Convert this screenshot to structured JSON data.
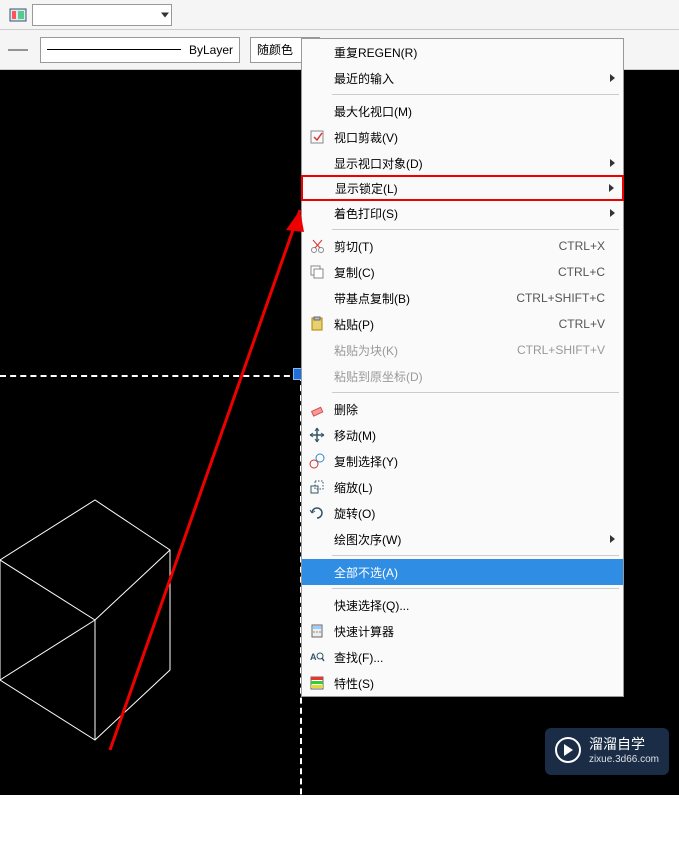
{
  "toolbar": {
    "layer_dropdown_value": "",
    "linetype_label": "ByLayer",
    "color_label": "随颜色"
  },
  "menu": {
    "regen": "重复REGEN(R)",
    "recent": "最近的输入",
    "maximize_viewport": "最大化视口(M)",
    "viewport_clip": "视口剪裁(V)",
    "show_viewport_obj": "显示视口对象(D)",
    "show_lock": "显示锁定(L)",
    "shade_plot": "着色打印(S)",
    "cut": "剪切(T)",
    "copy": "复制(C)",
    "copy_basept": "带基点复制(B)",
    "paste": "粘贴(P)",
    "paste_block": "粘贴为块(K)",
    "paste_origin": "粘贴到原坐标(D)",
    "erase": "删除",
    "move": "移动(M)",
    "copy_selection": "复制选择(Y)",
    "scale": "缩放(L)",
    "rotate": "旋转(O)",
    "draworder": "绘图次序(W)",
    "deselect_all": "全部不选(A)",
    "quick_select": "快速选择(Q)...",
    "quickcalc": "快速计算器",
    "find": "查找(F)...",
    "properties": "特性(S)"
  },
  "shortcuts": {
    "cut": "CTRL+X",
    "copy": "CTRL+C",
    "copy_basept": "CTRL+SHIFT+C",
    "paste": "CTRL+V",
    "paste_block": "CTRL+SHIFT+V"
  },
  "watermark": {
    "title": "溜溜自学",
    "sub": "zixue.3d66.com"
  }
}
